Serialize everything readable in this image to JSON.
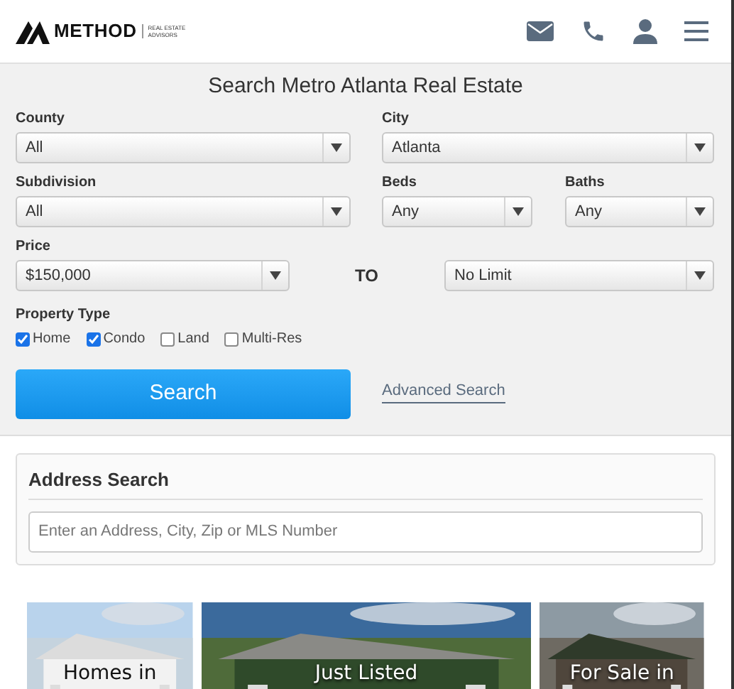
{
  "header": {
    "logo_name": "METHOD",
    "logo_tagline_1": "REAL ESTATE",
    "logo_tagline_2": "ADVISORS"
  },
  "search_form": {
    "title": "Search Metro Atlanta Real Estate",
    "selects": [
      {
        "label": "County",
        "value": "All"
      },
      {
        "label": "City",
        "value": "Atlanta"
      },
      {
        "label": "Subdivision",
        "value": "All"
      },
      {
        "label": "Beds",
        "value": "Any"
      },
      {
        "label": "Baths",
        "value": "Any"
      }
    ],
    "price": {
      "label": "Price",
      "min": "$150,000",
      "separator": "TO",
      "max": "No Limit"
    },
    "property_type": {
      "label": "Property Type",
      "options": [
        {
          "label": "Home",
          "checked": true
        },
        {
          "label": "Condo",
          "checked": true
        },
        {
          "label": "Land",
          "checked": false
        },
        {
          "label": "Multi-Res",
          "checked": false
        }
      ]
    },
    "search_button": "Search",
    "advanced_link": "Advanced Search"
  },
  "address_search": {
    "title": "Address Search",
    "placeholder": "Enter an Address, City, Zip or MLS Number"
  },
  "tiles": [
    {
      "title": "Homes in",
      "kind": "light"
    },
    {
      "title": "Just Listed",
      "kind": "dark"
    },
    {
      "title": "For Sale in",
      "kind": "dark"
    }
  ]
}
